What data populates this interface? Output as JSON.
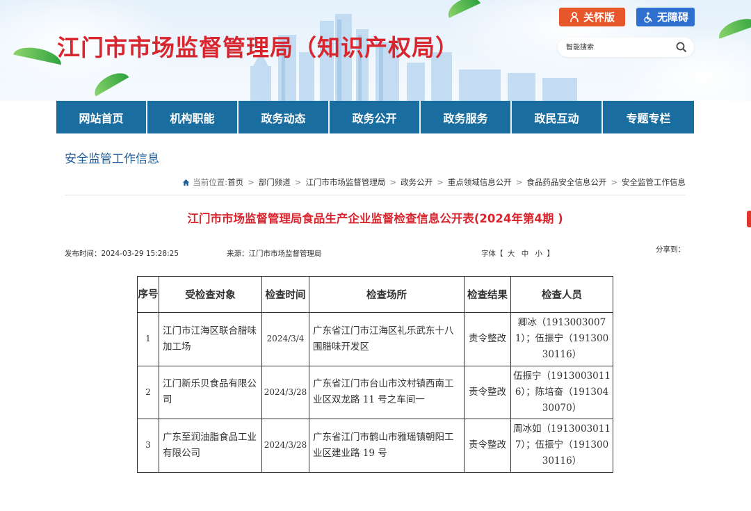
{
  "header": {
    "site_title": "江门市市场监督管理局（知识产权局）",
    "care_label": "关怀版",
    "access_label": "无障碍",
    "search_placeholder": "智能搜索"
  },
  "nav": {
    "items": [
      "网站首页",
      "机构职能",
      "政务动态",
      "政务公开",
      "政务服务",
      "政民互动",
      "专题专栏"
    ]
  },
  "section": {
    "title": "安全监管工作信息"
  },
  "breadcrumb": {
    "prefix": "当前位置:",
    "items": [
      "首页",
      "部门频道",
      "江门市市场监督管理局",
      "政务公开",
      "重点领域信息公开",
      "食品药品安全信息公开",
      "安全监管工作信息"
    ],
    "separator": ">"
  },
  "article": {
    "title": "江门市市场监督管理局食品生产企业监督检查信息公开表(2024年第4期 )",
    "publish_time": "发布时间：2024-03-29 15:28:25",
    "source": "来源：江门市市场监督管理局",
    "font_label": "字体【",
    "font_large": "大",
    "font_medium": "中",
    "font_small": "小",
    "font_close": "】",
    "share_label": "分享到："
  },
  "table": {
    "headers": [
      "序号",
      "受检查对象",
      "检查时间",
      "检查场所",
      "检查结果",
      "检查人员"
    ],
    "rows": [
      {
        "no": "1",
        "target": "江门市江海区联合腊味加工场",
        "date": "2024/3/4",
        "place": "广东省江门市江海区礼乐武东十八围腊味开发区",
        "result": "责令整改",
        "inspectors": "卿冰（19130030071）；伍振宁（19130030116）"
      },
      {
        "no": "2",
        "target": "江门新乐贝食品有限公司",
        "date": "2024/3/28",
        "place": "广东省江门市台山市汶村镇西南工业区双龙路 11 号之车间一",
        "result": "责令整改",
        "inspectors": "伍振宁（19130030116）；陈培奋（19130430070）"
      },
      {
        "no": "3",
        "target": "广东至润油脂食品工业有限公司",
        "date": "2024/3/28",
        "place": "广东省江门市鹤山市雅瑶镇朝阳工业区建业路 19 号",
        "result": "责令整改",
        "inspectors": "周冰如（19130030117）；伍振宁（19130030116）"
      }
    ]
  },
  "colors": {
    "title_red": "#d8262f",
    "nav_blue": "#1a6e9f",
    "care_orange": "#e8572c",
    "access_blue": "#2f6fcf",
    "section_blue": "#1f5d98"
  }
}
